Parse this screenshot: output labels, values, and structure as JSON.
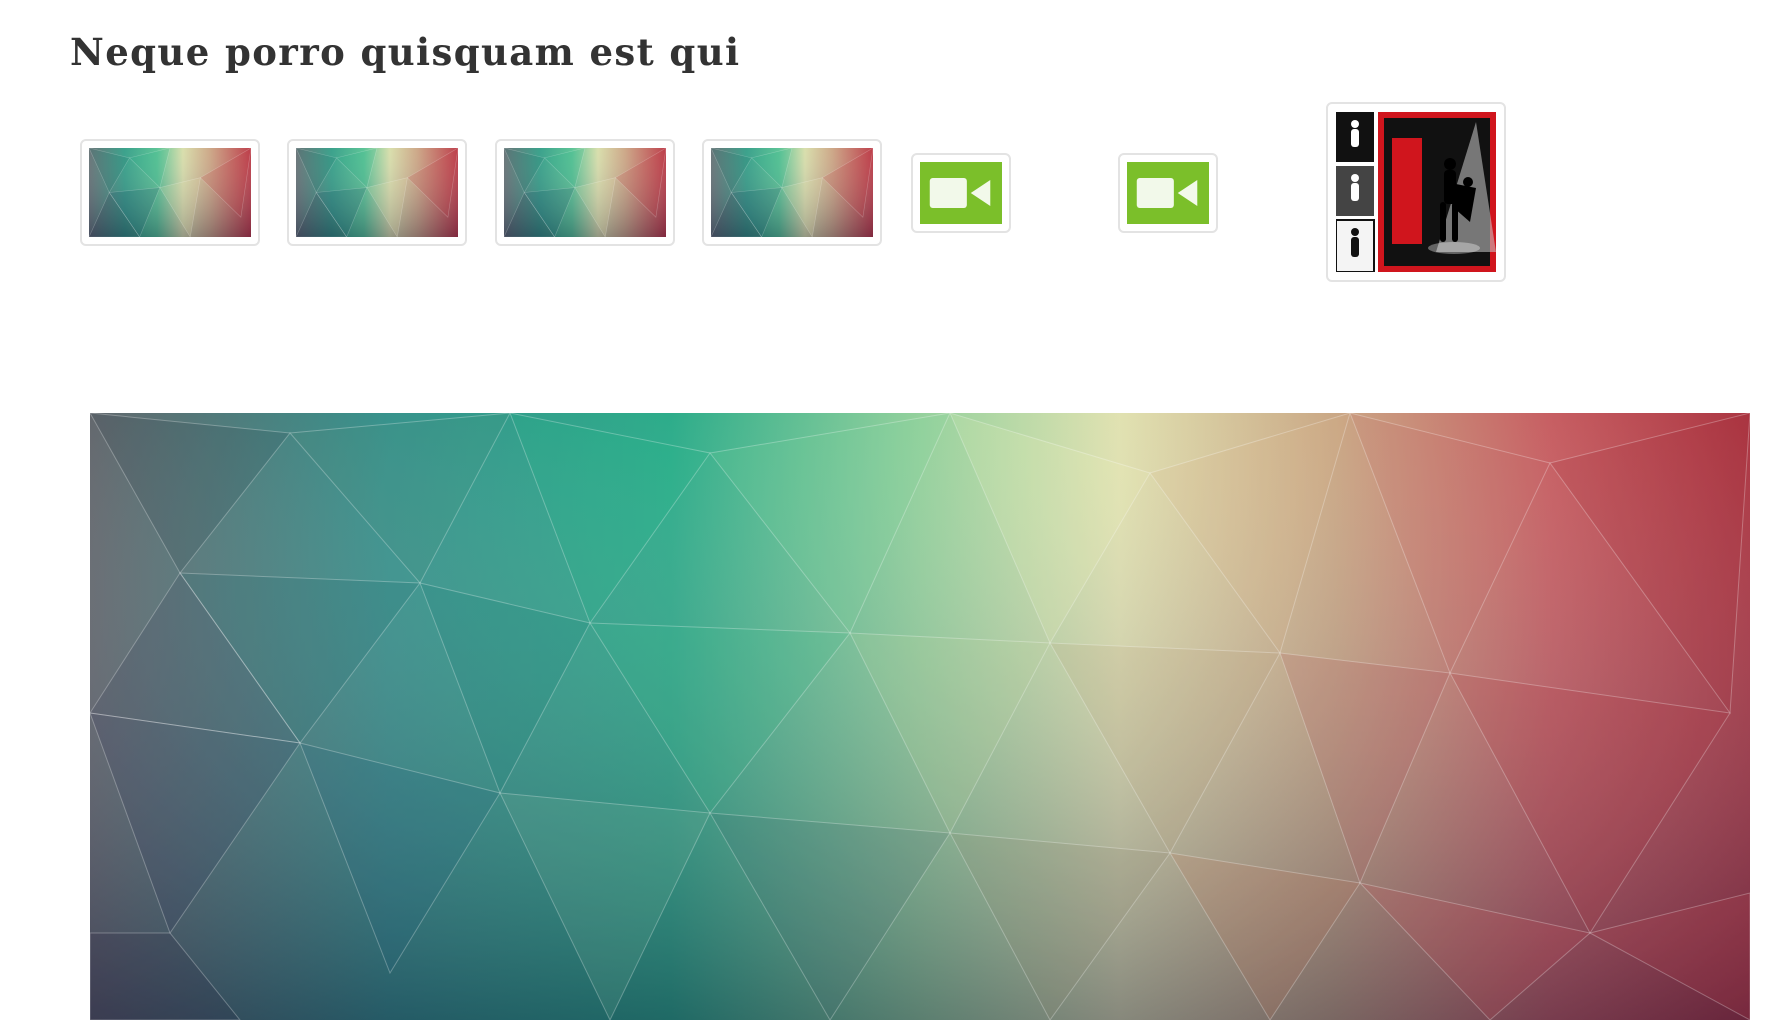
{
  "page": {
    "title": "Neque porro quisquam est qui"
  },
  "gallery": {
    "items": [
      {
        "type": "image",
        "icon": "polygon-thumbnail-icon"
      },
      {
        "type": "image",
        "icon": "polygon-thumbnail-icon"
      },
      {
        "type": "image",
        "icon": "polygon-thumbnail-icon"
      },
      {
        "type": "image",
        "icon": "polygon-thumbnail-icon"
      },
      {
        "type": "video",
        "icon": "video-camera-icon"
      },
      {
        "type": "video",
        "icon": "video-camera-icon"
      },
      {
        "type": "image",
        "icon": "dance-poster-icon"
      }
    ]
  },
  "featured": {
    "type": "image",
    "icon": "polygon-background-image"
  },
  "colors": {
    "title_text": "#333333",
    "thumb_border": "#e3e3e3",
    "video_green": "#7bbf2a",
    "poster_red": "#d0151d",
    "poly_teal": "#1fa57f",
    "poly_cream": "#d9d7a0",
    "poly_red": "#c23a45"
  }
}
